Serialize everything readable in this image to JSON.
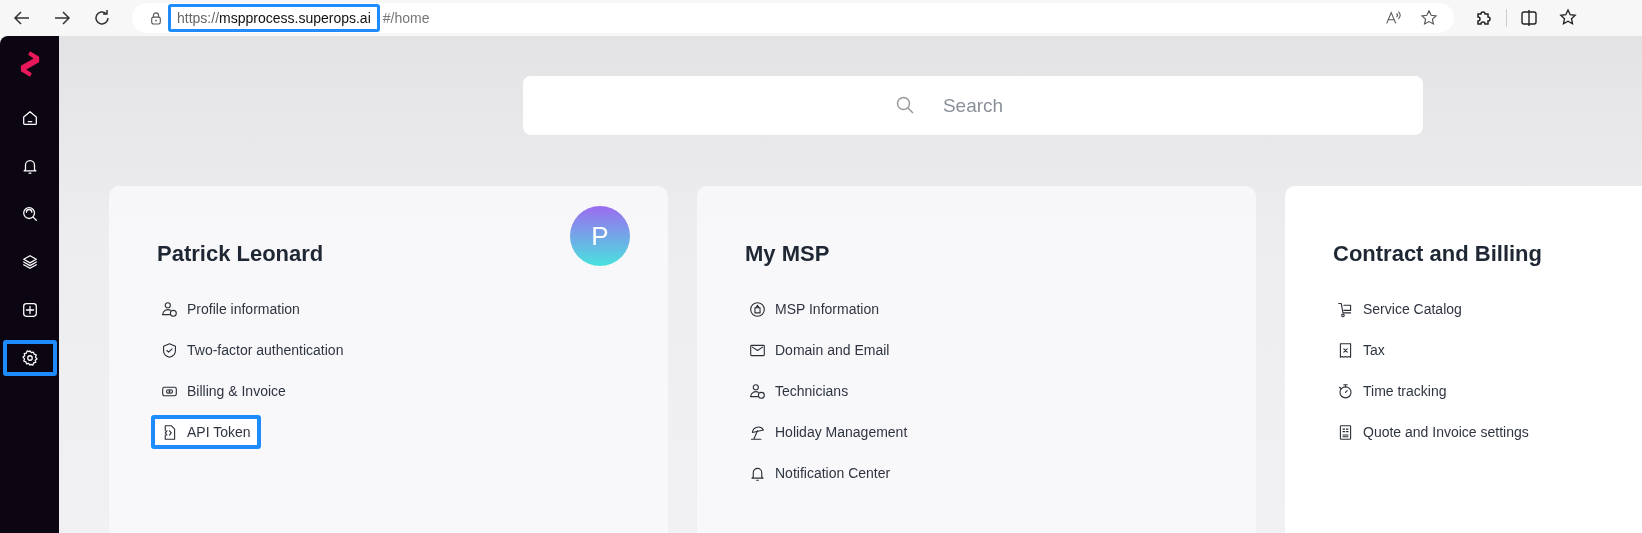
{
  "address_bar": {
    "scheme": "https://",
    "host": "mspprocess.superops.ai",
    "path": "#/home",
    "highlighted": true
  },
  "sidebar": {
    "items": [
      {
        "kind": "home",
        "highlighted": false
      },
      {
        "kind": "bell",
        "highlighted": false
      },
      {
        "kind": "search",
        "highlighted": false
      },
      {
        "kind": "layers",
        "highlighted": false
      },
      {
        "kind": "plus",
        "highlighted": false
      },
      {
        "kind": "gear",
        "highlighted": true
      }
    ]
  },
  "search": {
    "placeholder": "Search"
  },
  "cards": [
    {
      "title": "Patrick Leonard",
      "avatar": "P",
      "items": [
        {
          "label": "Profile information",
          "highlighted": false
        },
        {
          "label": "Two-factor authentication",
          "highlighted": false
        },
        {
          "label": "Billing & Invoice",
          "highlighted": false
        },
        {
          "label": "API Token",
          "highlighted": true
        }
      ]
    },
    {
      "title": "My MSP",
      "items": [
        {
          "label": "MSP Information",
          "highlighted": false
        },
        {
          "label": "Domain and Email",
          "highlighted": false
        },
        {
          "label": "Technicians",
          "highlighted": false
        },
        {
          "label": "Holiday Management",
          "highlighted": false
        },
        {
          "label": "Notification Center",
          "highlighted": false
        }
      ]
    },
    {
      "title": "Contract and Billing",
      "items": [
        {
          "label": "Service Catalog",
          "highlighted": false
        },
        {
          "label": "Tax",
          "highlighted": false
        },
        {
          "label": "Time tracking",
          "highlighted": false
        },
        {
          "label": "Quote and Invoice settings",
          "highlighted": false
        }
      ]
    }
  ]
}
